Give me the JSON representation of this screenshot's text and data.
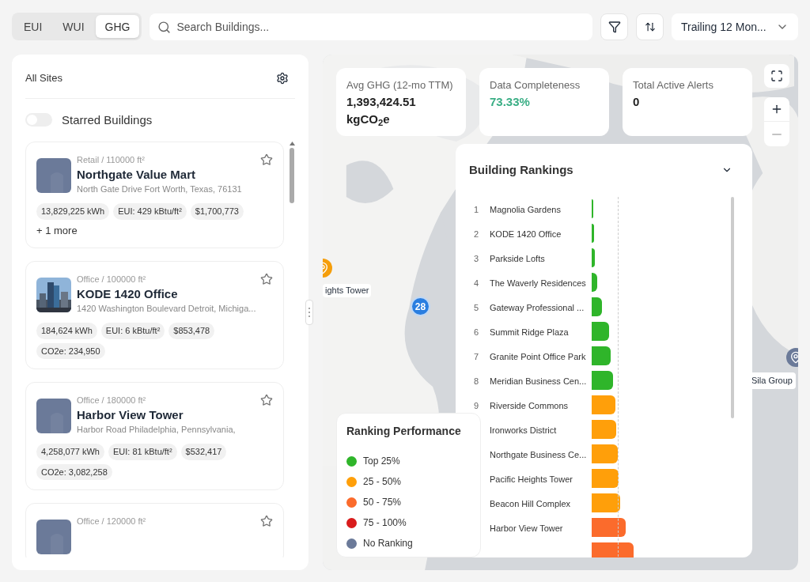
{
  "metric_tabs": [
    {
      "label": "EUI",
      "selected": false
    },
    {
      "label": "WUI",
      "selected": false
    },
    {
      "label": "GHG",
      "selected": true
    }
  ],
  "search": {
    "placeholder": "Search Buildings..."
  },
  "period": {
    "value": "Trailing 12 Mon..."
  },
  "sidebar": {
    "title": "All Sites",
    "starred_toggle": {
      "label": "Starred Buildings",
      "on": false
    },
    "buildings": [
      {
        "meta": "Retail / 110000 ft²",
        "name": "Northgate Value Mart",
        "address": "North Gate Drive Fort Worth, Texas, 76131",
        "kind": "placeholder",
        "starred": false,
        "chips": [
          "13,829,225 kWh",
          "EUI: 429 kBtu/ft²",
          "$1,700,773"
        ],
        "more": "+ 1 more"
      },
      {
        "meta": "Office / 100000 ft²",
        "name": "KODE 1420 Office",
        "address": "1420 Washington Boulevard Detroit, Michiga...",
        "starred": false,
        "chips": [
          "184,624 kWh",
          "EUI: 6 kBtu/ft²",
          "$853,478",
          "CO2e: 234,950"
        ]
      },
      {
        "meta": "Office / 180000 ft²",
        "name": "Harbor View Tower",
        "address": "Harbor Road Philadelphia, Pennsylvania,",
        "kind": "placeholder",
        "starred": false,
        "chips": [
          "4,258,077 kWh",
          "EUI: 81 kBtu/ft²",
          "$532,417",
          "CO2e: 3,082,258"
        ]
      },
      {
        "meta": "Office / 120000 ft²",
        "kind": "placeholder",
        "starred": false
      }
    ]
  },
  "stats": [
    {
      "label": "Avg GHG (12-mo TTM)",
      "value": "1,393,424.51 kgCO$_{2}$e",
      "kind": "plain"
    },
    {
      "label": "Data Completeness",
      "value": "73.33%",
      "kind": "good"
    },
    {
      "label": "Total Active Alerts",
      "value": "0",
      "kind": "plain"
    }
  ],
  "map_markers": [
    {
      "label": "ights Tower",
      "color": "#f59e0b"
    },
    {
      "label": "Sila Group",
      "color": "#6b7a99"
    }
  ],
  "cluster": {
    "count": "28"
  },
  "rankings": {
    "title": "Building Rankings",
    "items": [
      {
        "rank": "1",
        "name": "Magnolia Gardens",
        "level": 0.03,
        "color": "#2fb52a"
      },
      {
        "rank": "2",
        "name": "KODE 1420 Office",
        "level": 0.05,
        "color": "#2fb52a"
      },
      {
        "rank": "3",
        "name": "Parkside Lofts",
        "level": 0.07,
        "color": "#2fb52a"
      },
      {
        "rank": "4",
        "name": "The Waverly Residences",
        "level": 0.12,
        "color": "#2fb52a"
      },
      {
        "rank": "5",
        "name": "Gateway Professional ...",
        "level": 0.22,
        "color": "#2fb52a"
      },
      {
        "rank": "6",
        "name": "Summit Ridge Plaza",
        "level": 0.37,
        "color": "#2fb52a"
      },
      {
        "rank": "7",
        "name": "Granite Point Office Park",
        "level": 0.4,
        "color": "#2fb52a"
      },
      {
        "rank": "8",
        "name": "Meridian Business Cen...",
        "level": 0.45,
        "color": "#2fb52a"
      },
      {
        "rank": "9",
        "name": "Riverside Commons",
        "level": 0.5,
        "color": "#ff9f0a"
      },
      {
        "name": "Ironworks District",
        "level": 0.52,
        "color": "#ff9f0a"
      },
      {
        "name": "Northgate Business Ce...",
        "level": 0.55,
        "color": "#ff9f0a"
      },
      {
        "name": "Pacific Heights Tower",
        "level": 0.57,
        "color": "#ff9f0a"
      },
      {
        "name": "Beacon Hill Complex",
        "level": 0.6,
        "color": "#ff9f0a"
      },
      {
        "name": "Harbor View Tower",
        "level": 0.72,
        "color": "#fb6b2c"
      },
      {
        "level": 0.88,
        "color": "#fb6b2c"
      }
    ]
  },
  "legend": {
    "title": "Ranking Performance",
    "items": [
      {
        "label": "Top 25%",
        "color": "#2fb52a"
      },
      {
        "label": "25 - 50%",
        "color": "#ff9f0a"
      },
      {
        "label": "50 - 75%",
        "color": "#fb6b2c"
      },
      {
        "label": "75 - 100%",
        "color": "#d91c1c"
      },
      {
        "label": "No Ranking",
        "color": "#6b7a99"
      }
    ]
  }
}
